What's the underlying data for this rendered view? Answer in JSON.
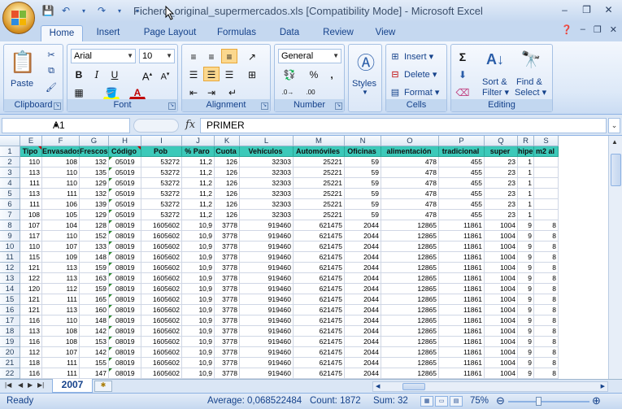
{
  "app": {
    "title": "Fichero_original_supermercados.xls  [Compatibility Mode]  -  Microsoft Excel"
  },
  "tabs": [
    "Home",
    "Insert",
    "Page Layout",
    "Formulas",
    "Data",
    "Review",
    "View"
  ],
  "ribbon": {
    "clipboard": {
      "label": "Clipboard",
      "paste": "Paste"
    },
    "font": {
      "label": "Font",
      "name": "Arial",
      "size": "10"
    },
    "alignment": {
      "label": "Alignment"
    },
    "number": {
      "label": "Number",
      "format": "General"
    },
    "styles": {
      "label": "Styles"
    },
    "cells": {
      "label": "Cells",
      "insert": "Insert",
      "delete": "Delete",
      "format": "Format"
    },
    "editing": {
      "label": "Editing",
      "sort": "Sort &",
      "filter": "Filter",
      "find": "Find &",
      "select": "Select"
    }
  },
  "formula_bar": {
    "name_box": "A1",
    "fx": "fx",
    "content": "PRIMER"
  },
  "columns": [
    "E",
    "F",
    "G",
    "H",
    "I",
    "J",
    "K",
    "L",
    "M",
    "N",
    "O",
    "P",
    "Q",
    "R",
    "S"
  ],
  "header_row": [
    "Tipo",
    "Envasados",
    "Frescos",
    "Código",
    "Pob",
    "% Paro",
    "Cuota",
    "Vehículos",
    "Automóviles",
    "Oficinas",
    "alimentación",
    "tradicional",
    "super",
    "hiper",
    "m2 al"
  ],
  "rows": [
    [
      "110",
      "108",
      "132",
      "05019",
      "53272",
      "11,2",
      "126",
      "32303",
      "25221",
      "59",
      "478",
      "455",
      "23",
      "1",
      ""
    ],
    [
      "113",
      "110",
      "135",
      "05019",
      "53272",
      "11,2",
      "126",
      "32303",
      "25221",
      "59",
      "478",
      "455",
      "23",
      "1",
      ""
    ],
    [
      "111",
      "110",
      "129",
      "05019",
      "53272",
      "11,2",
      "126",
      "32303",
      "25221",
      "59",
      "478",
      "455",
      "23",
      "1",
      ""
    ],
    [
      "113",
      "111",
      "132",
      "05019",
      "53272",
      "11,2",
      "126",
      "32303",
      "25221",
      "59",
      "478",
      "455",
      "23",
      "1",
      ""
    ],
    [
      "111",
      "106",
      "139",
      "05019",
      "53272",
      "11,2",
      "126",
      "32303",
      "25221",
      "59",
      "478",
      "455",
      "23",
      "1",
      ""
    ],
    [
      "108",
      "105",
      "129",
      "05019",
      "53272",
      "11,2",
      "126",
      "32303",
      "25221",
      "59",
      "478",
      "455",
      "23",
      "1",
      ""
    ],
    [
      "107",
      "104",
      "128",
      "08019",
      "1605602",
      "10,9",
      "3778",
      "919460",
      "621475",
      "2044",
      "12865",
      "11861",
      "1004",
      "9",
      "8"
    ],
    [
      "117",
      "110",
      "152",
      "08019",
      "1605602",
      "10,9",
      "3778",
      "919460",
      "621475",
      "2044",
      "12865",
      "11861",
      "1004",
      "9",
      "8"
    ],
    [
      "110",
      "107",
      "133",
      "08019",
      "1605602",
      "10,9",
      "3778",
      "919460",
      "621475",
      "2044",
      "12865",
      "11861",
      "1004",
      "9",
      "8"
    ],
    [
      "115",
      "109",
      "148",
      "08019",
      "1605602",
      "10,9",
      "3778",
      "919460",
      "621475",
      "2044",
      "12865",
      "11861",
      "1004",
      "9",
      "8"
    ],
    [
      "121",
      "113",
      "159",
      "08019",
      "1605602",
      "10,9",
      "3778",
      "919460",
      "621475",
      "2044",
      "12865",
      "11861",
      "1004",
      "9",
      "8"
    ],
    [
      "122",
      "113",
      "163",
      "08019",
      "1605602",
      "10,9",
      "3778",
      "919460",
      "621475",
      "2044",
      "12865",
      "11861",
      "1004",
      "9",
      "8"
    ],
    [
      "120",
      "112",
      "159",
      "08019",
      "1605602",
      "10,9",
      "3778",
      "919460",
      "621475",
      "2044",
      "12865",
      "11861",
      "1004",
      "9",
      "8"
    ],
    [
      "121",
      "111",
      "165",
      "08019",
      "1605602",
      "10,9",
      "3778",
      "919460",
      "621475",
      "2044",
      "12865",
      "11861",
      "1004",
      "9",
      "8"
    ],
    [
      "121",
      "113",
      "160",
      "08019",
      "1605602",
      "10,9",
      "3778",
      "919460",
      "621475",
      "2044",
      "12865",
      "11861",
      "1004",
      "9",
      "8"
    ],
    [
      "116",
      "110",
      "148",
      "08019",
      "1605602",
      "10,9",
      "3778",
      "919460",
      "621475",
      "2044",
      "12865",
      "11861",
      "1004",
      "9",
      "8"
    ],
    [
      "113",
      "108",
      "142",
      "08019",
      "1605602",
      "10,9",
      "3778",
      "919460",
      "621475",
      "2044",
      "12865",
      "11861",
      "1004",
      "9",
      "8"
    ],
    [
      "116",
      "108",
      "153",
      "08019",
      "1605602",
      "10,9",
      "3778",
      "919460",
      "621475",
      "2044",
      "12865",
      "11861",
      "1004",
      "9",
      "8"
    ],
    [
      "112",
      "107",
      "142",
      "08019",
      "1605602",
      "10,9",
      "3778",
      "919460",
      "621475",
      "2044",
      "12865",
      "11861",
      "1004",
      "9",
      "8"
    ],
    [
      "118",
      "111",
      "155",
      "08019",
      "1605602",
      "10,9",
      "3778",
      "919460",
      "621475",
      "2044",
      "12865",
      "11861",
      "1004",
      "9",
      "8"
    ],
    [
      "116",
      "111",
      "147",
      "08019",
      "1605602",
      "10,9",
      "3778",
      "919460",
      "621475",
      "2044",
      "12865",
      "11861",
      "1004",
      "9",
      "8"
    ]
  ],
  "sheet_tab": "2007",
  "status": {
    "ready": "Ready",
    "average": "Average: 0,068522484",
    "count": "Count: 1872",
    "sum": "Sum: 32",
    "zoom": "75%"
  }
}
